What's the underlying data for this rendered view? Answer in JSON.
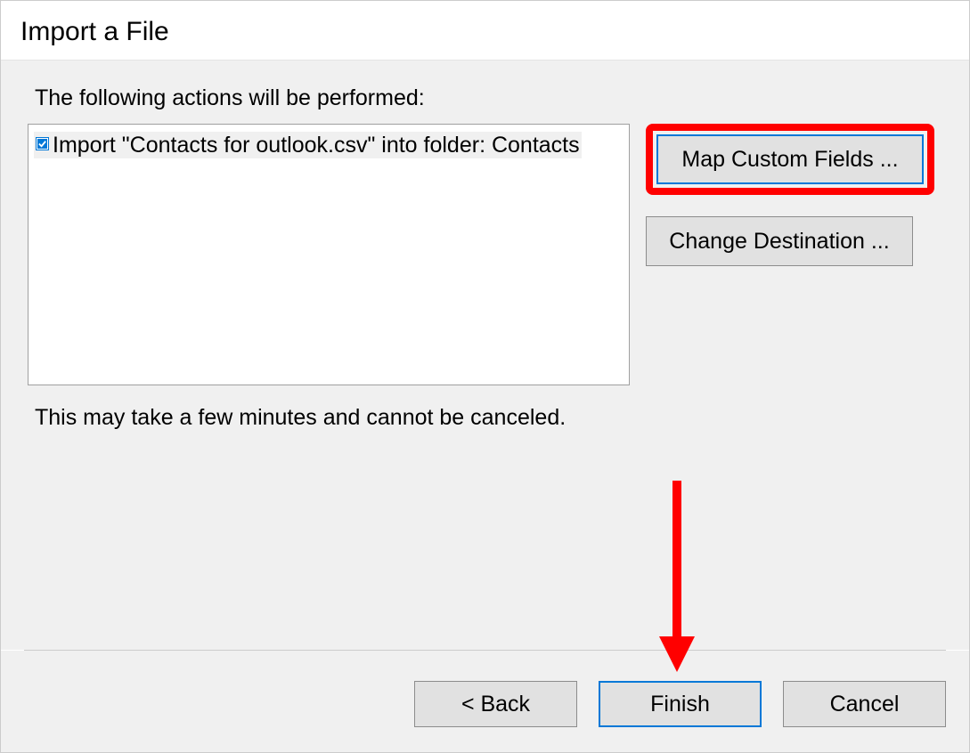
{
  "dialog": {
    "title": "Import a File",
    "prompt": "The following actions will be performed:",
    "note": "This may take a few minutes and cannot be canceled.",
    "actions": [
      {
        "checked": true,
        "text": "Import \"Contacts for outlook.csv\" into folder: Contacts"
      }
    ],
    "side_buttons": {
      "map_fields": "Map Custom Fields ...",
      "change_destination": "Change Destination ..."
    },
    "nav_buttons": {
      "back": "< Back",
      "finish": "Finish",
      "cancel": "Cancel"
    }
  },
  "annotation": {
    "highlight_color": "#ff0000",
    "arrow_color": "#ff0000"
  }
}
